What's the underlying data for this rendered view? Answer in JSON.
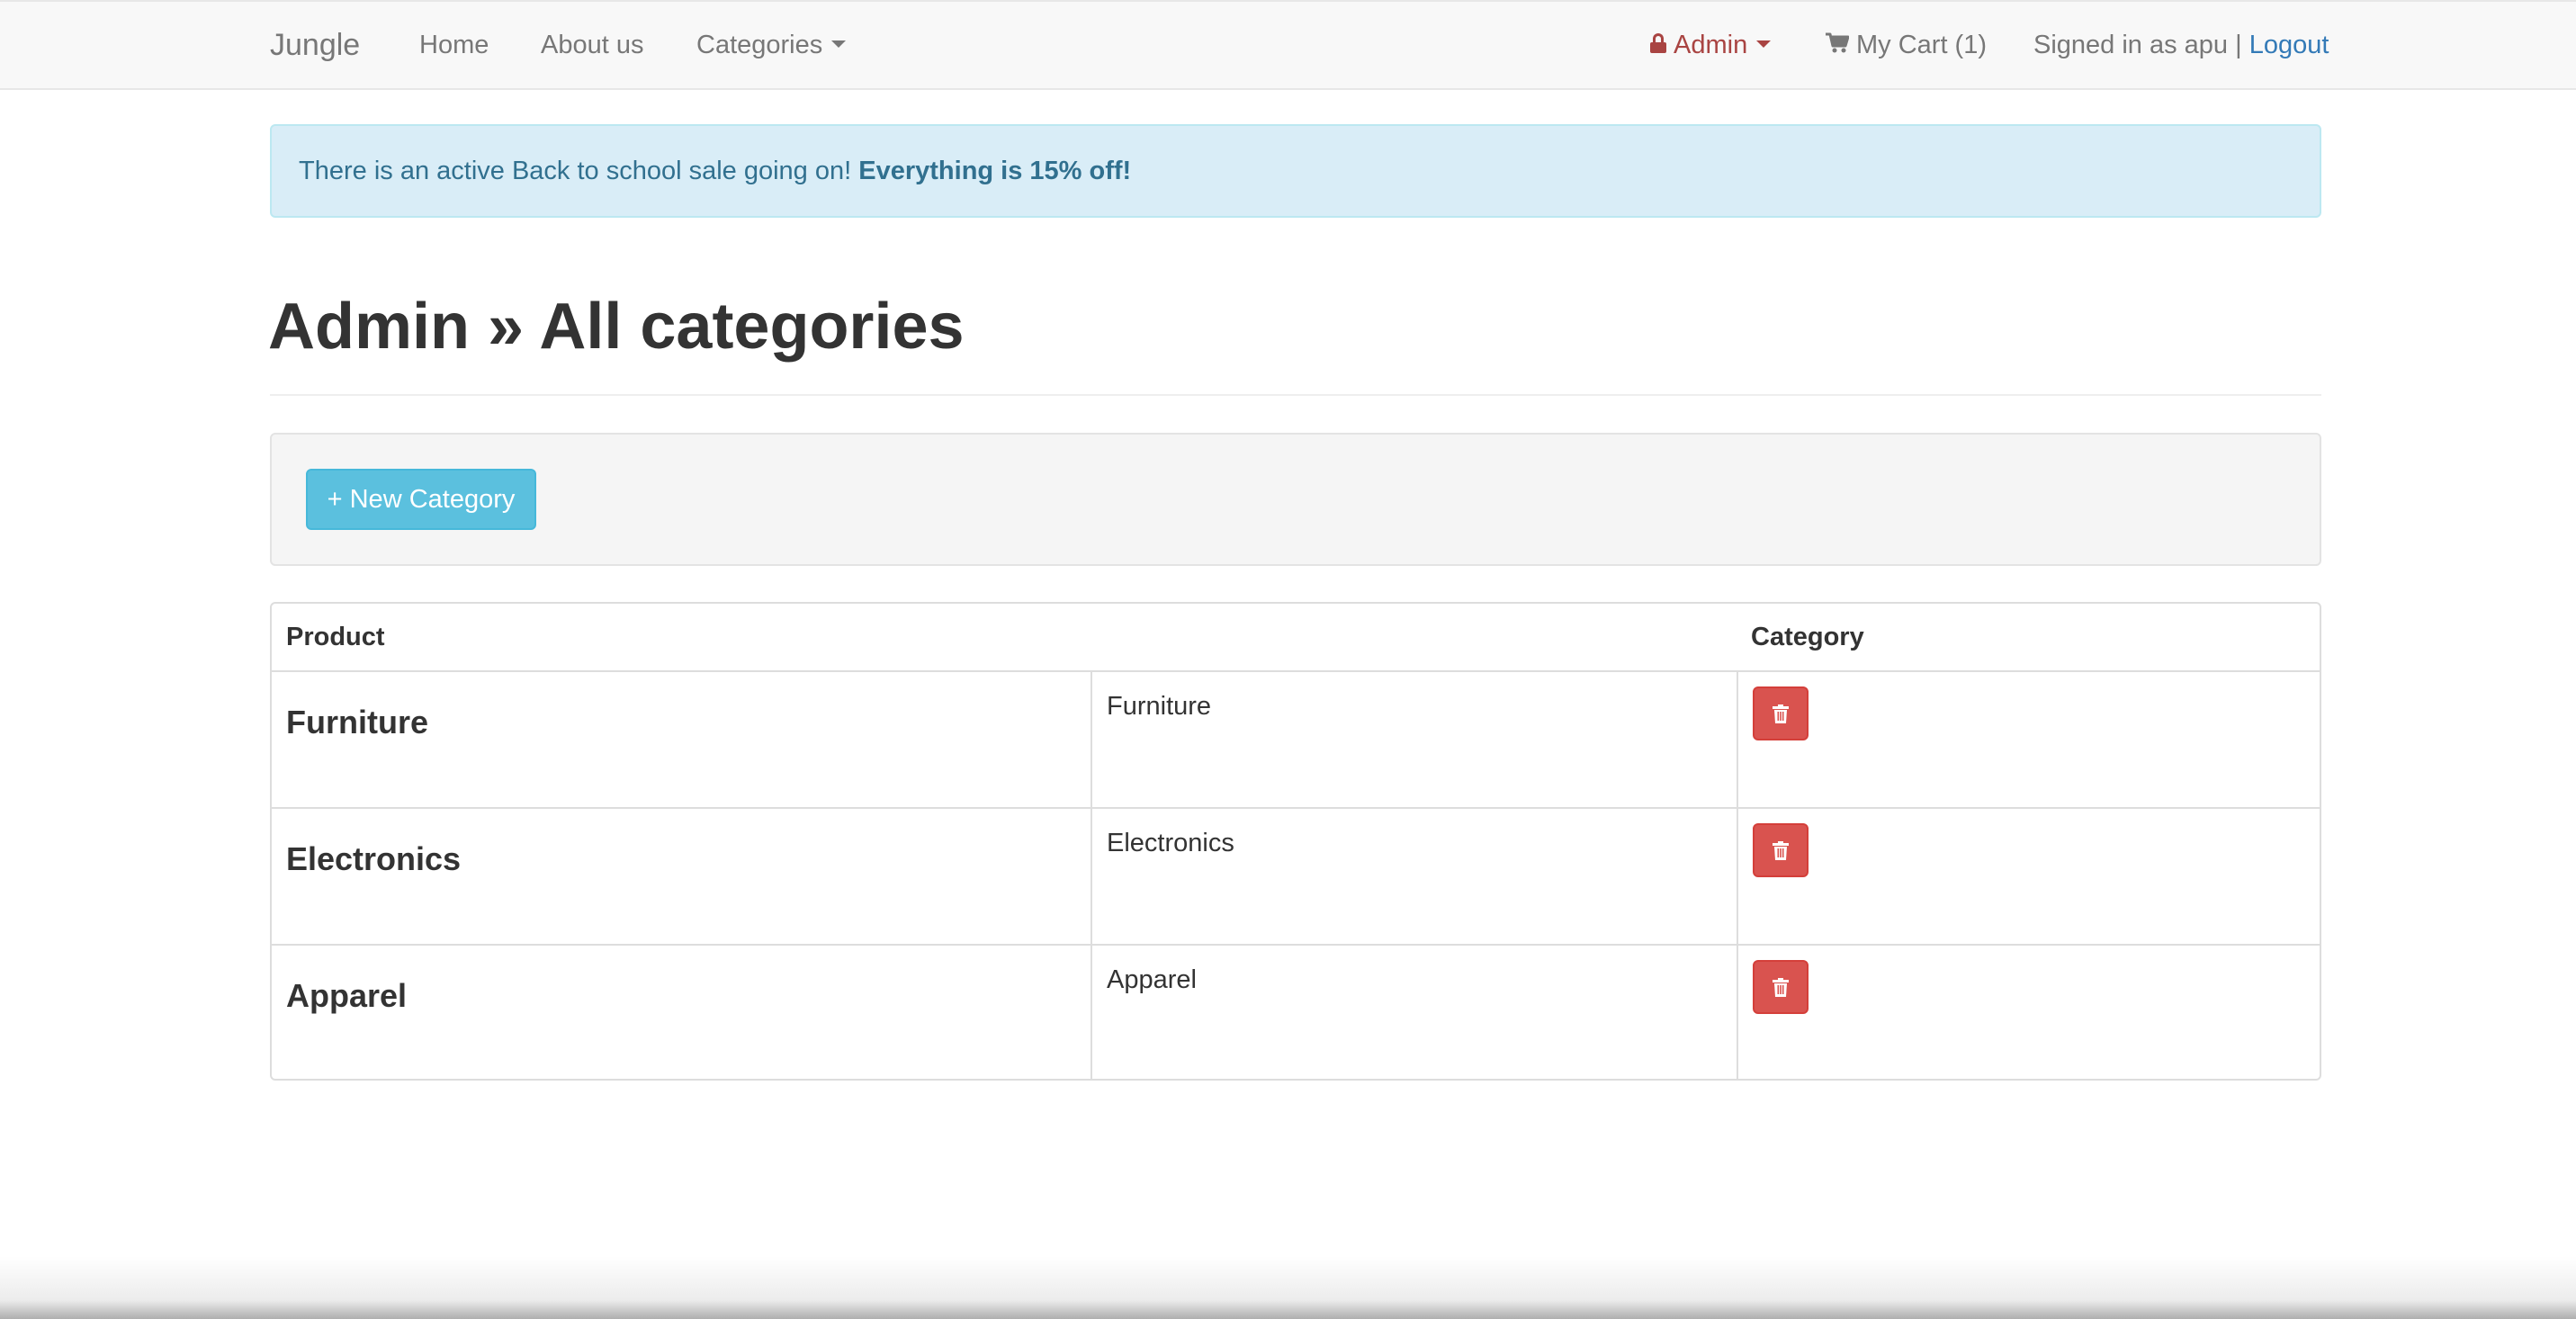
{
  "navbar": {
    "brand": "Jungle",
    "links": [
      {
        "label": "Home"
      },
      {
        "label": "About us"
      },
      {
        "label": "Categories"
      }
    ],
    "admin_label": "Admin",
    "cart_label": "My Cart (1)",
    "signed_in_text": "Signed in as apu |",
    "logout_label": "Logout"
  },
  "alert": {
    "text": "There is an active Back to school sale going on! ",
    "highlight": "Everything is 15% off!"
  },
  "page": {
    "title": "Admin » All categories"
  },
  "toolbar": {
    "new_category_label": "+ New Category"
  },
  "table": {
    "headers": [
      "Product",
      "Category"
    ],
    "rows": [
      {
        "name": "Furniture",
        "description": "Furniture"
      },
      {
        "name": "Electronics",
        "description": "Electronics"
      },
      {
        "name": "Apparel",
        "description": "Apparel"
      }
    ]
  },
  "icons": {
    "admin": "lock-icon",
    "cart": "shopping-cart-icon",
    "delete": "trash-icon"
  },
  "colors": {
    "navbar_bg": "#f8f8f8",
    "admin_accent": "#a94442",
    "link": "#337ab7",
    "alert_bg": "#d9edf7",
    "alert_text": "#31708f",
    "info_button": "#5bc0de",
    "danger_button": "#d9534f"
  }
}
